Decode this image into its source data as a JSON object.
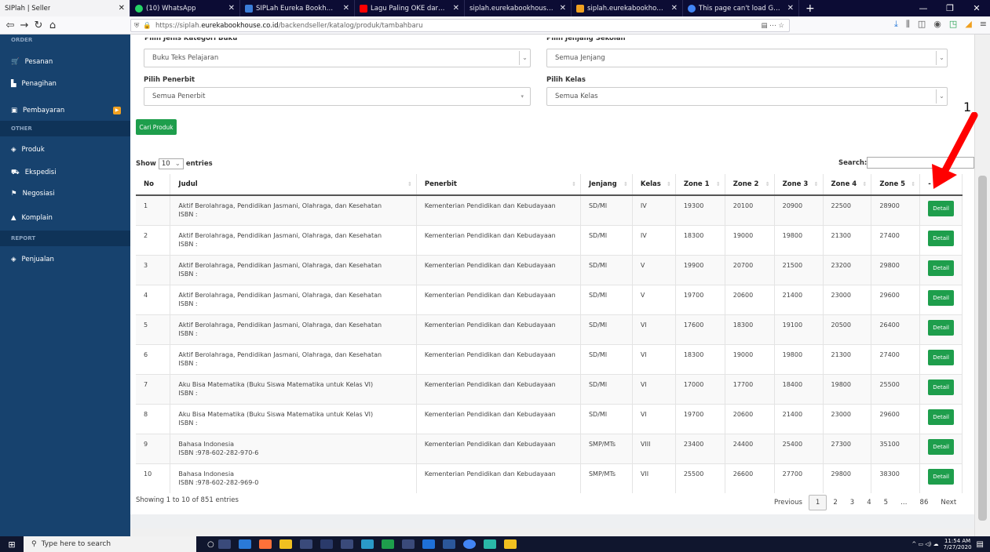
{
  "browser": {
    "tabs": [
      {
        "title": "SIPlah | Seller",
        "icon": "page-icon",
        "color": "#888888",
        "active": true
      },
      {
        "title": "(10) WhatsApp",
        "icon": "whatsapp-icon",
        "color": "#25d366"
      },
      {
        "title": "SIPLah Eureka Bookhouse | Bel",
        "icon": "eureka-icon",
        "color": "#3b7dd8"
      },
      {
        "title": "Lagu Paling OKE dari Nugie",
        "icon": "youtube-icon",
        "color": "#ff0000"
      },
      {
        "title": "siplah.eurekabookhouse.co.id/back",
        "icon": "page-icon",
        "color": "#888888"
      },
      {
        "title": "siplah.eurekabookhouse.co.id",
        "icon": "eureka-icon",
        "color": "#f0a020"
      },
      {
        "title": "This page can't load Google M",
        "icon": "google-icon",
        "color": "#4285f4"
      }
    ],
    "new_tab": "+",
    "url_prefix": "https://siplah.",
    "url_domain": "eurekabookhouse.co.id",
    "url_path": "/backendseller/katalog/produk/tambahbaru"
  },
  "sidebar": {
    "section_order": "ORDER",
    "items_top": [
      {
        "label": "Pesanan",
        "icon": "cart-icon"
      },
      {
        "label": "Penagihan",
        "icon": "document-icon"
      },
      {
        "label": "Pembayaran",
        "icon": "money-icon"
      }
    ],
    "section_other": "OTHER",
    "items_other": [
      {
        "label": "Produk",
        "icon": "tag-icon"
      },
      {
        "label": "Ekspedisi",
        "icon": "truck-icon"
      },
      {
        "label": "Negosiasi",
        "icon": "flag-icon"
      },
      {
        "label": "Komplain",
        "icon": "warning-icon"
      }
    ],
    "section_report": "REPORT",
    "items_report": [
      {
        "label": "Penjualan",
        "icon": "tag-icon"
      }
    ]
  },
  "filters": {
    "kategori_label": "Pilih Jenis Kategori Buku",
    "kategori_value": "Buku Teks Pelajaran",
    "jenjang_label": "Pilih Jenjang Sekolah",
    "jenjang_value": "Semua Jenjang",
    "penerbit_label": "Pilih Penerbit",
    "penerbit_value": "Semua Penerbit",
    "kelas_label": "Pilih Kelas",
    "kelas_value": "Semua Kelas",
    "search_button": "Cari Produk"
  },
  "table": {
    "show_label": "Show",
    "entries_value": "10",
    "entries_label": "entries",
    "search_label": "Search:",
    "columns": [
      "No",
      "Judul",
      "Penerbit",
      "Jenjang",
      "Kelas",
      "Zone 1",
      "Zone 2",
      "Zone 3",
      "Zone 4",
      "Zone 5",
      "-"
    ],
    "detail_label": "Detail",
    "rows": [
      {
        "no": "1",
        "judul": "Aktif Berolahraga, Pendidikan Jasmani, Olahraga, dan Kesehatan",
        "isbn": "ISBN :",
        "penerbit": "Kementerian Pendidikan dan Kebudayaan",
        "jenjang": "SD/MI",
        "kelas": "IV",
        "z1": "19300",
        "z2": "20100",
        "z3": "20900",
        "z4": "22500",
        "z5": "28900"
      },
      {
        "no": "2",
        "judul": "Aktif Berolahraga, Pendidikan Jasmani, Olahraga, dan Kesehatan",
        "isbn": "ISBN :",
        "penerbit": "Kementerian Pendidikan dan Kebudayaan",
        "jenjang": "SD/MI",
        "kelas": "IV",
        "z1": "18300",
        "z2": "19000",
        "z3": "19800",
        "z4": "21300",
        "z5": "27400"
      },
      {
        "no": "3",
        "judul": "Aktif Berolahraga, Pendidikan Jasmani, Olahraga, dan Kesehatan",
        "isbn": "ISBN :",
        "penerbit": "Kementerian Pendidikan dan Kebudayaan",
        "jenjang": "SD/MI",
        "kelas": "V",
        "z1": "19900",
        "z2": "20700",
        "z3": "21500",
        "z4": "23200",
        "z5": "29800"
      },
      {
        "no": "4",
        "judul": "Aktif Berolahraga, Pendidikan Jasmani, Olahraga, dan Kesehatan",
        "isbn": "ISBN :",
        "penerbit": "Kementerian Pendidikan dan Kebudayaan",
        "jenjang": "SD/MI",
        "kelas": "V",
        "z1": "19700",
        "z2": "20600",
        "z3": "21400",
        "z4": "23000",
        "z5": "29600"
      },
      {
        "no": "5",
        "judul": "Aktif Berolahraga, Pendidikan Jasmani, Olahraga, dan Kesehatan",
        "isbn": "ISBN :",
        "penerbit": "Kementerian Pendidikan dan Kebudayaan",
        "jenjang": "SD/MI",
        "kelas": "VI",
        "z1": "17600",
        "z2": "18300",
        "z3": "19100",
        "z4": "20500",
        "z5": "26400"
      },
      {
        "no": "6",
        "judul": "Aktif Berolahraga, Pendidikan Jasmani, Olahraga, dan Kesehatan",
        "isbn": "ISBN :",
        "penerbit": "Kementerian Pendidikan dan Kebudayaan",
        "jenjang": "SD/MI",
        "kelas": "VI",
        "z1": "18300",
        "z2": "19000",
        "z3": "19800",
        "z4": "21300",
        "z5": "27400"
      },
      {
        "no": "7",
        "judul": "Aku Bisa Matematika (Buku Siswa Matematika untuk Kelas VI)",
        "isbn": "ISBN :",
        "penerbit": "Kementerian Pendidikan dan Kebudayaan",
        "jenjang": "SD/MI",
        "kelas": "VI",
        "z1": "17000",
        "z2": "17700",
        "z3": "18400",
        "z4": "19800",
        "z5": "25500"
      },
      {
        "no": "8",
        "judul": "Aku Bisa Matematika (Buku Siswa Matematika untuk Kelas VI)",
        "isbn": "ISBN :",
        "penerbit": "Kementerian Pendidikan dan Kebudayaan",
        "jenjang": "SD/MI",
        "kelas": "VI",
        "z1": "19700",
        "z2": "20600",
        "z3": "21400",
        "z4": "23000",
        "z5": "29600"
      },
      {
        "no": "9",
        "judul": "Bahasa Indonesia",
        "isbn": "ISBN :978-602-282-970-6",
        "penerbit": "Kementerian Pendidikan dan Kebudayaan",
        "jenjang": "SMP/MTs",
        "kelas": "VIII",
        "z1": "23400",
        "z2": "24400",
        "z3": "25400",
        "z4": "27300",
        "z5": "35100"
      },
      {
        "no": "10",
        "judul": "Bahasa Indonesia",
        "isbn": "ISBN :978-602-282-969-0",
        "penerbit": "Kementerian Pendidikan dan Kebudayaan",
        "jenjang": "SMP/MTs",
        "kelas": "VII",
        "z1": "25500",
        "z2": "26600",
        "z3": "27700",
        "z4": "29800",
        "z5": "38300"
      }
    ],
    "info": "Showing 1 to 10 of 851 entries",
    "pagination": {
      "previous": "Previous",
      "pages": [
        "1",
        "2",
        "3",
        "4",
        "5",
        "…",
        "86"
      ],
      "current": "1",
      "next": "Next"
    }
  },
  "annotation": {
    "label": "1",
    "color": "#ff0000"
  },
  "taskbar": {
    "search_placeholder": "Type here to search",
    "time": "11:54 AM",
    "date": "7/27/2020"
  },
  "colors": {
    "sidebar": "#17426e",
    "accent_green": "#1e9e4c",
    "tabbar": "#0c0c34"
  }
}
